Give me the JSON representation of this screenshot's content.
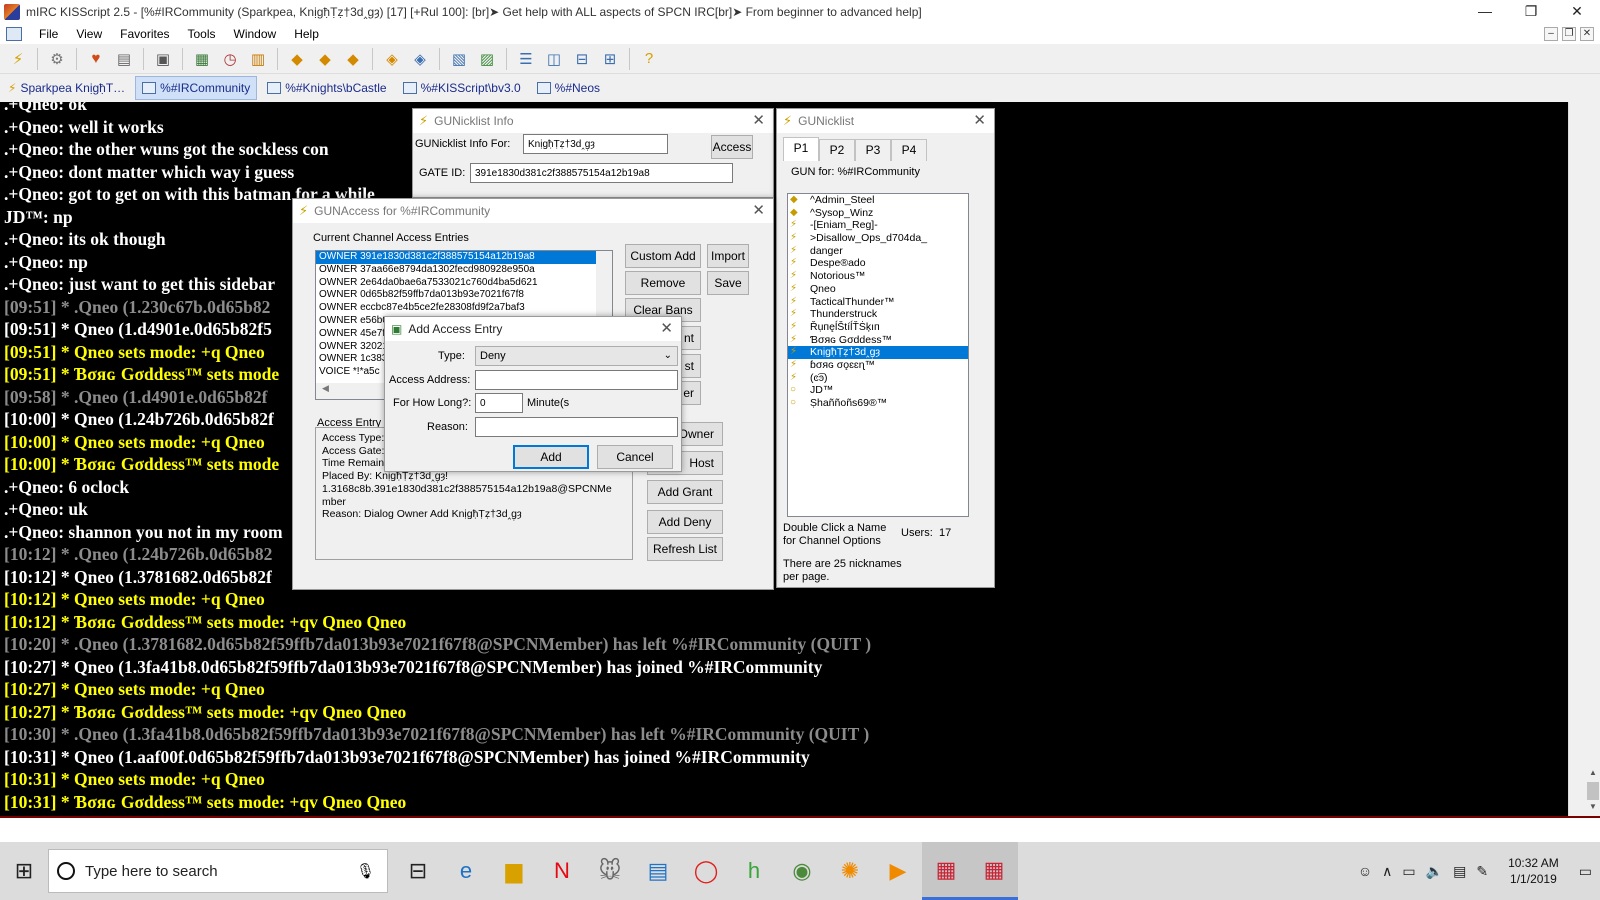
{
  "app": {
    "title": "mIRC KISScript 2.5 - [%#IRCommunity (Sparkpea, Knịgħ̣Ṭẓ†3d‸g̣ȝ) [17] [+Rul 100]: [br]➤ Get help with ALL aspects of SPCN IRC[br]➤ From beginner to advanced help]",
    "window_controls": [
      "—",
      "❐",
      "✕"
    ]
  },
  "menu": {
    "items": [
      "File",
      "View",
      "Favorites",
      "Tools",
      "Window",
      "Help"
    ]
  },
  "switchbar": {
    "tabs": [
      {
        "label": "Sparkpea Knịgħ̣T…",
        "active": false
      },
      {
        "label": "%#IRCommunity",
        "active": true
      },
      {
        "label": "%#Knights\\bCastle",
        "active": false
      },
      {
        "label": "%#KISScript\\bv3.0",
        "active": false
      },
      {
        "label": "%#Neos",
        "active": false
      }
    ]
  },
  "chat": {
    "lines": [
      {
        "text": ".+Qneo: ok",
        "color": "white"
      },
      {
        "text": ".+Qneo: well it works",
        "color": "white"
      },
      {
        "text": ".+Qneo: the other wuns got the sockless con",
        "color": "white"
      },
      {
        "text": ".+Qneo: dont matter which way i guess",
        "color": "white"
      },
      {
        "text": ".+Qneo: got to get on with this batman for a while",
        "color": "white"
      },
      {
        "text": "JD™: np",
        "color": "white"
      },
      {
        "text": ".+Qneo: its ok though",
        "color": "white"
      },
      {
        "text": ".+Qneo: np",
        "color": "white"
      },
      {
        "text": ".+Qneo: just want to get this sidebar",
        "color": "white"
      },
      {
        "text": "[09:51] * .Qneo (1.230c67b.0d65b82",
        "color": "gray"
      },
      {
        "text": "[09:51] * Qneo (1.d4901e.0d65b82f5",
        "color": "white"
      },
      {
        "text": "[09:51] * Qneo sets mode: +q Qneo",
        "color": "yellow"
      },
      {
        "text": "[09:51] * Ɓσяɢ Gσddess™ sets mode",
        "color": "yellow"
      },
      {
        "text": "[09:58] * .Qneo (1.d4901e.0d65b82f",
        "color": "gray"
      },
      {
        "text": "[10:00] * Qneo (1.24b726b.0d65b82f",
        "color": "white"
      },
      {
        "text": "[10:00] * Qneo sets mode: +q Qneo",
        "color": "yellow"
      },
      {
        "text": "[10:00] * Ɓσяɢ Gσddess™ sets mode",
        "color": "yellow"
      },
      {
        "text": ".+Qneo: 6 oclock",
        "color": "white"
      },
      {
        "text": ".+Qneo: uk",
        "color": "white"
      },
      {
        "text": ".+Qneo: shannon you not in my room",
        "color": "white"
      },
      {
        "text": "[10:12] * .Qneo (1.24b726b.0d65b82",
        "color": "gray"
      },
      {
        "text": "[10:12] * Qneo (1.3781682.0d65b82f",
        "color": "white"
      },
      {
        "text": "[10:12] * Qneo sets mode: +q Qneo",
        "color": "yellow"
      },
      {
        "text": "[10:12] * Ɓσяɢ Gσddess™ sets mode: +qv Qneo Qneo",
        "color": "yellow"
      },
      {
        "text": "[10:20] * .Qneo (1.3781682.0d65b82f59ffb7da013b93e7021f67f8@SPCNMember) has left %#IRCommunity (QUIT )",
        "color": "gray"
      },
      {
        "text": "[10:27] * Qneo (1.3fa41b8.0d65b82f59ffb7da013b93e7021f67f8@SPCNMember) has joined %#IRCommunity",
        "color": "white"
      },
      {
        "text": "[10:27] * Qneo sets mode: +q Qneo",
        "color": "yellow"
      },
      {
        "text": "[10:27] * Ɓσяɢ Gσddess™ sets mode: +qv Qneo Qneo",
        "color": "yellow"
      },
      {
        "text": "[10:30] * .Qneo (1.3fa41b8.0d65b82f59ffb7da013b93e7021f67f8@SPCNMember) has left %#IRCommunity (QUIT )",
        "color": "gray"
      },
      {
        "text": "[10:31] * Qneo (1.aaf00f.0d65b82f59ffb7da013b93e7021f67f8@SPCNMember) has joined %#IRCommunity",
        "color": "white"
      },
      {
        "text": "[10:31] * Qneo sets mode: +q Qneo",
        "color": "yellow"
      },
      {
        "text": "[10:31] * Ɓσяɢ Gσddess™ sets mode: +qv Qneo Qneo",
        "color": "yellow"
      }
    ]
  },
  "info_dialog": {
    "title": "GUNicklist Info",
    "for_label": "GUNicklist Info For:",
    "for_value": "Knịgħ̣Ṭẓ†3d‸g̣ȝ",
    "access_button": "Access",
    "gate_label": "GATE ID:",
    "gate_value": "391e1830d381c2f388575154a12b19a8"
  },
  "nicklist_dialog": {
    "title": "GUNicklist",
    "tabs": [
      "P1",
      "P2",
      "P3",
      "P4"
    ],
    "gun_for": "GUN for: %#IRCommunity",
    "nicks": [
      {
        "name": "^Admin_Steel",
        "selected": false
      },
      {
        "name": "^Sysop_Winz",
        "selected": false
      },
      {
        "name": "-[Eniam_Reg]-",
        "selected": false
      },
      {
        "name": ">Disallow_Ops_d704da_",
        "selected": false
      },
      {
        "name": "danger",
        "selected": false
      },
      {
        "name": "Despe®ado",
        "selected": false
      },
      {
        "name": "Notorious™",
        "selected": false
      },
      {
        "name": "Qneo",
        "selected": false
      },
      {
        "name": "TacticalThunder™",
        "selected": false
      },
      {
        "name": "Thunderstruck",
        "selected": false
      },
      {
        "name": "ŘụпęĺŠtíĺŤṠķıп",
        "selected": false
      },
      {
        "name": "Ɓσяɢ Gσddess™",
        "selected": false
      },
      {
        "name": "Knịgħ̣Ṭẓ†3d‸g̣ȝ",
        "selected": true
      },
      {
        "name": "ɓσяɢ σǫɛɛɳ™",
        "selected": false
      },
      {
        "name": "(ͼ͡ͽ)",
        "selected": false
      },
      {
        "name": "JD™",
        "selected": false
      },
      {
        "name": "Ṣhaññoñs69®™",
        "selected": false
      }
    ],
    "hint": "Double Click a Name for Channel Options",
    "users_label": "Users:",
    "users_count": "17",
    "footer": "There are 25 nicknames per page."
  },
  "access_dialog": {
    "title": "GUNAccess for %#IRCommunity",
    "list_label": "Current Channel Access Entries",
    "entries": [
      {
        "text": "OWNER 391e1830d381c2f388575154a12b19a8",
        "selected": true
      },
      {
        "text": "OWNER 37aa66e8794da1302fecd980928e950a",
        "selected": false
      },
      {
        "text": "OWNER 2e64da0bae6a7533021c760d4ba5d621",
        "selected": false
      },
      {
        "text": "OWNER 0d65b82f59ffb7da013b93e7021f67f8",
        "selected": false
      },
      {
        "text": "OWNER eccbc87e4b5ce2fe28308fd9f2a7baf3",
        "selected": false
      },
      {
        "text": "OWNER e56b0",
        "selected": false
      },
      {
        "text": "OWNER 45e7f",
        "selected": false
      },
      {
        "text": "OWNER 32021",
        "selected": false
      },
      {
        "text": "OWNER 1c383",
        "selected": false
      },
      {
        "text": "VOICE *!*a5c",
        "selected": false
      }
    ],
    "buttons": {
      "custom_add": "Custom Add",
      "import": "Import",
      "remove": "Remove",
      "save": "Save",
      "clear_bans": "Clear Bans",
      "b4": "nt",
      "b5": "st",
      "b6": "er",
      "owner": "Owner",
      "host": "Host",
      "add_grant": "Add Grant",
      "add_deny": "Add Deny",
      "refresh": "Refresh List"
    },
    "info_label": "Access Entry I",
    "info_lines": [
      "Access Type:",
      "Access Gate:",
      "Time Remainin",
      "Placed By: Knịgħ̣Ṭẓ†3d‸g̣ȝ!",
      "1.3168c8b.391e1830d381c2f388575154a12b19a8@SPCNMe",
      "mber",
      "Reason: Dialog Owner Add Knịgħ̣Ṭẓ†3d‸g̣ȝ"
    ]
  },
  "add_dialog": {
    "title": "Add Access Entry",
    "type_label": "Type:",
    "type_value": "Deny",
    "address_label": "Access Address:",
    "address_value": "",
    "howlong_label": "For How Long?:",
    "howlong_value": "0",
    "minutes_label": "Minute(s",
    "reason_label": "Reason:",
    "reason_value": "",
    "add_button": "Add",
    "cancel_button": "Cancel"
  },
  "taskbar": {
    "search_placeholder": "Type here to search",
    "apps": [
      {
        "icon": "task-view-icon",
        "glyph": "⊟"
      },
      {
        "icon": "edge-icon",
        "glyph": "e"
      },
      {
        "icon": "file-explorer-icon",
        "glyph": "▆"
      },
      {
        "icon": "netflix-icon",
        "glyph": "N"
      },
      {
        "icon": "mouse-app-icon",
        "glyph": "🐭"
      },
      {
        "icon": "document-app-icon",
        "glyph": "▤"
      },
      {
        "icon": "red-app-icon",
        "glyph": "◯"
      },
      {
        "icon": "h-app-icon",
        "glyph": "h"
      },
      {
        "icon": "chrome-icon",
        "glyph": "◉"
      },
      {
        "icon": "orange-app-icon",
        "glyph": "✺"
      },
      {
        "icon": "media-app-icon",
        "glyph": "▶"
      },
      {
        "icon": "mirc-icon-1",
        "glyph": "▦"
      },
      {
        "icon": "mirc-icon-2",
        "glyph": "▦"
      }
    ],
    "time": "10:32 AM",
    "date": "1/1/2019"
  },
  "colors": {
    "chat_white": "#ffffff",
    "chat_gray": "#8c8c8c",
    "chat_yellow": "#ffff00",
    "selection": "#0078d7"
  }
}
